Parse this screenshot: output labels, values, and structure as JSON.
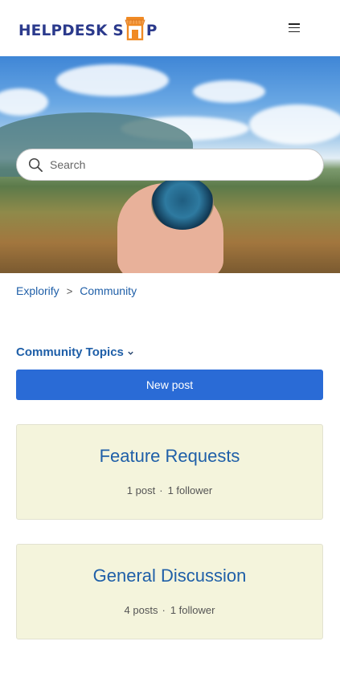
{
  "header": {
    "logo_text_left": "HELPDESK S",
    "logo_text_right": "P",
    "menu_icon": "hamburger-icon"
  },
  "hero": {
    "search_placeholder": "Search",
    "search_icon": "search-icon"
  },
  "breadcrumb": {
    "items": [
      "Explorify",
      "Community"
    ],
    "separator": ">"
  },
  "topics": {
    "title": "Community Topics",
    "new_post_label": "New post",
    "cards": [
      {
        "title": "Feature Requests",
        "posts": "1 post",
        "followers": "1 follower"
      },
      {
        "title": "General Discussion",
        "posts": "4 posts",
        "followers": "1 follower"
      }
    ]
  },
  "colors": {
    "link": "#1f5fa8",
    "button": "#2a6bd6",
    "card_bg": "#f4f4dc",
    "logo_navy": "#2b3a8c",
    "logo_orange": "#f08a24"
  }
}
